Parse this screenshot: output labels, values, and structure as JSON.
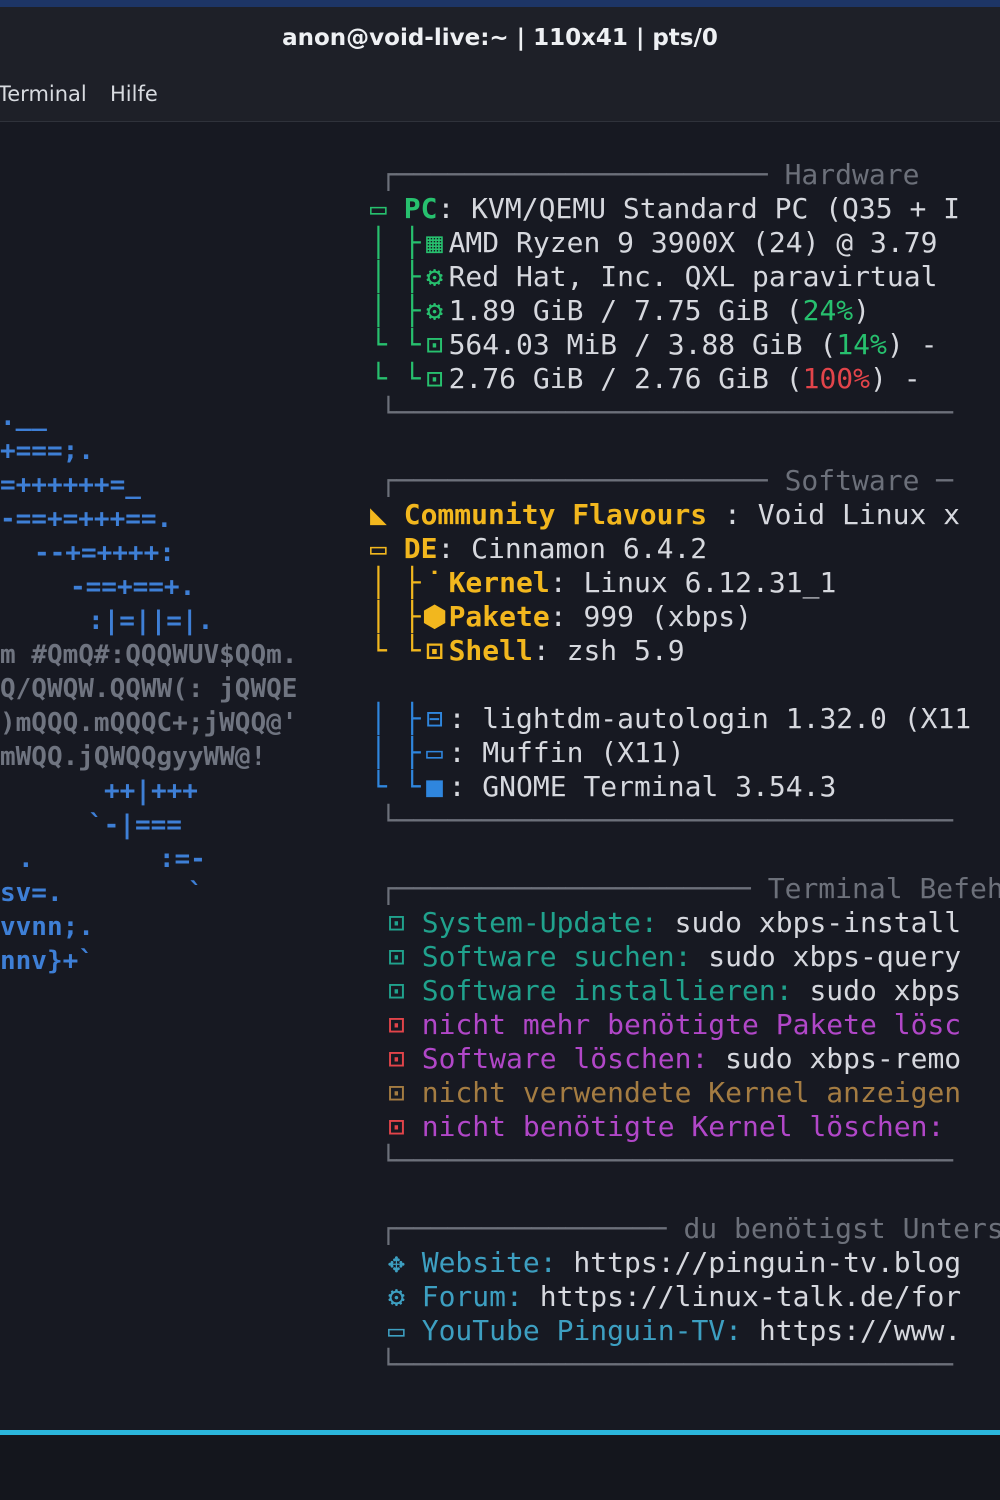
{
  "window": {
    "title": "anon@void-live:~ | 110x41 | pts/0"
  },
  "menu": {
    "terminal": "Terminal",
    "help": "Hilfe"
  },
  "ascii_art": [
    ".__",
    "+===;.",
    "=++++++=_",
    "-==+=+++==.",
    "--+=++++:",
    "-==+==+.",
    ":|=||=|.",
    "m #QmQ#:QQQWUV$QQm.",
    "Q/QWQW.QQWW(: jQWQE",
    ")mQQQ.mQQQC+;jWQQ@'",
    "mWQQ.jQWQQgyyWW@!",
    "++|+++",
    "`-|===",
    ".        :=-",
    "sv=.        `",
    "vvnn;.",
    "nnv}+`"
  ],
  "hardware": {
    "section_title": "Hardware",
    "pc_label": "PC",
    "pc_value": ": KVM/QEMU Standard PC (Q35 + I",
    "cpu_value": "AMD Ryzen 9 3900X (24) @ 3.79",
    "gpu_value": "Red Hat, Inc. QXL paravirtual",
    "memory_value": "1.89 GiB / 7.75 GiB (",
    "memory_percent": "24%",
    "memory_close": ")",
    "swap_value": "564.03 MiB / 3.88 GiB (",
    "swap_percent": "14%",
    "swap_close": ") -",
    "disk_value": "2.76 GiB / 2.76 GiB (",
    "disk_percent": "100%",
    "disk_close": ") -"
  },
  "software": {
    "section_title": "Software",
    "distro_label": "Community Flavours",
    "distro_value": " : Void Linux x",
    "de_label": "DE",
    "de_value": ": Cinnamon 6.4.2",
    "kernel_label": "Kernel",
    "kernel_value": ": Linux 6.12.31_1",
    "packages_label": "Pakete",
    "packages_value": ": 999 (xbps)",
    "shell_label": "Shell",
    "shell_value": ": zsh 5.9",
    "lm_value": ": lightdm-autologin 1.32.0 (X11",
    "wm_value": ": Muffin (X11)",
    "term_value": ": GNOME Terminal 3.54.3"
  },
  "commands": {
    "section_title": "Terminal Befeh",
    "items": [
      {
        "label": "System-Update:",
        "value": " sudo xbps-install"
      },
      {
        "label": "Software suchen:",
        "value": " sudo xbps-query"
      },
      {
        "label": "Software installieren:",
        "value": " sudo xbps"
      },
      {
        "label": "nicht mehr benötigte Pakete lösc",
        "value": ""
      },
      {
        "label": "Software löschen:",
        "value": " sudo xbps-remo"
      },
      {
        "label": "nicht verwendete Kernel anzeigen",
        "value": ""
      },
      {
        "label": "nicht benötigte Kernel löschen:",
        "value": ""
      }
    ]
  },
  "support": {
    "section_title": "du benötigst Unterst",
    "website_label": "Website:",
    "website_value": " https://pinguin-tv.blog",
    "forum_label": "Forum:",
    "forum_value": " https://linux-talk.de/for",
    "youtube_label": "YouTube Pinguin-TV:",
    "youtube_value": " https://www."
  },
  "colors": {
    "background": "#171922",
    "titlebar": "#1e2028",
    "accent_line": "#2bb6dc",
    "green": "#27c06e",
    "yellow": "#f2b71e",
    "blue": "#2f86de",
    "purple": "#b147c8",
    "red": "#e2444a",
    "teal": "#20a28d"
  }
}
